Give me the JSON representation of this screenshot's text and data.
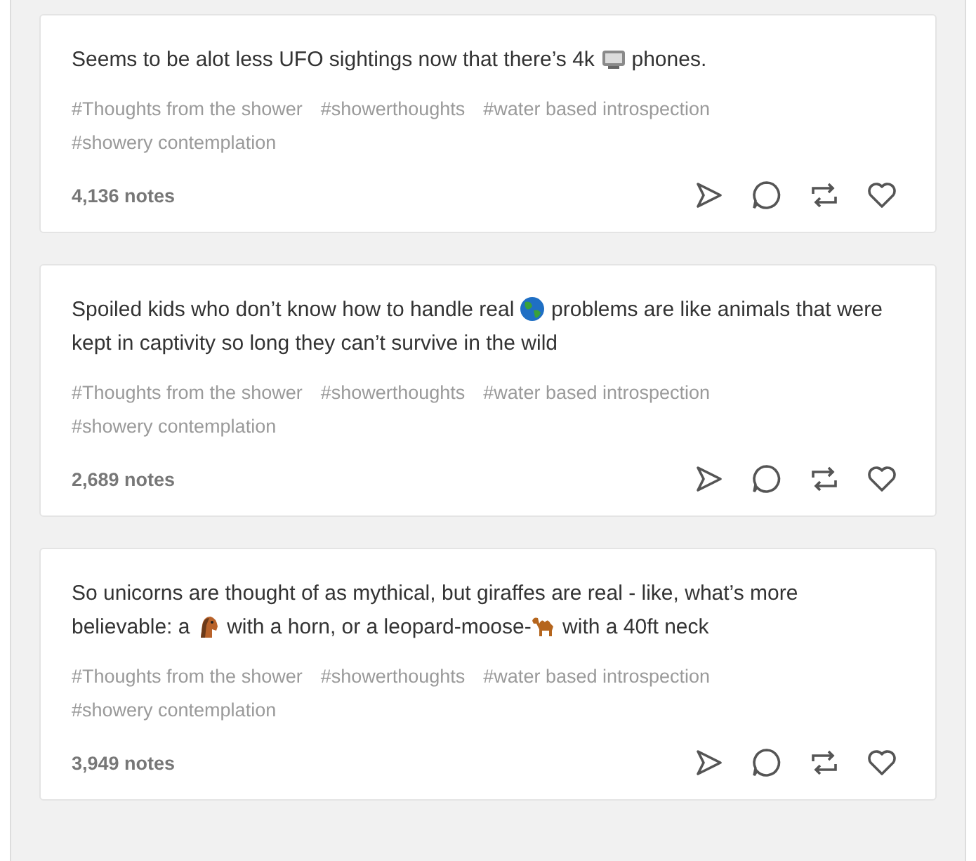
{
  "posts": [
    {
      "segments": [
        {
          "kind": "text",
          "text": "Seems to be alot less UFO sightings now that there’s 4k "
        },
        {
          "kind": "tv"
        },
        {
          "kind": "text",
          "text": " phones."
        }
      ],
      "tags": [
        "#Thoughts from the shower",
        "#showerthoughts",
        "#water based introspection",
        "#showery contemplation"
      ],
      "notes": "4,136 notes"
    },
    {
      "segments": [
        {
          "kind": "text",
          "text": "Spoiled kids who don’t know how to handle real "
        },
        {
          "kind": "globe"
        },
        {
          "kind": "text",
          "text": " problems are like animals that were kept in captivity so long they can’t survive in the wild"
        }
      ],
      "tags": [
        "#Thoughts from the shower",
        "#showerthoughts",
        "#water based introspection",
        "#showery contemplation"
      ],
      "notes": "2,689 notes"
    },
    {
      "segments": [
        {
          "kind": "text",
          "text": "So unicorns are thought of as mythical, but giraffes are real - like, what’s more believable: a "
        },
        {
          "kind": "horse"
        },
        {
          "kind": "text",
          "text": " with a horn, or a leopard-moose-"
        },
        {
          "kind": "camel"
        },
        {
          "kind": "text",
          "text": " with a 40ft neck"
        }
      ],
      "tags": [
        "#Thoughts from the shower",
        "#showerthoughts",
        "#water based introspection",
        "#showery contemplation"
      ],
      "notes": "3,949 notes"
    }
  ]
}
